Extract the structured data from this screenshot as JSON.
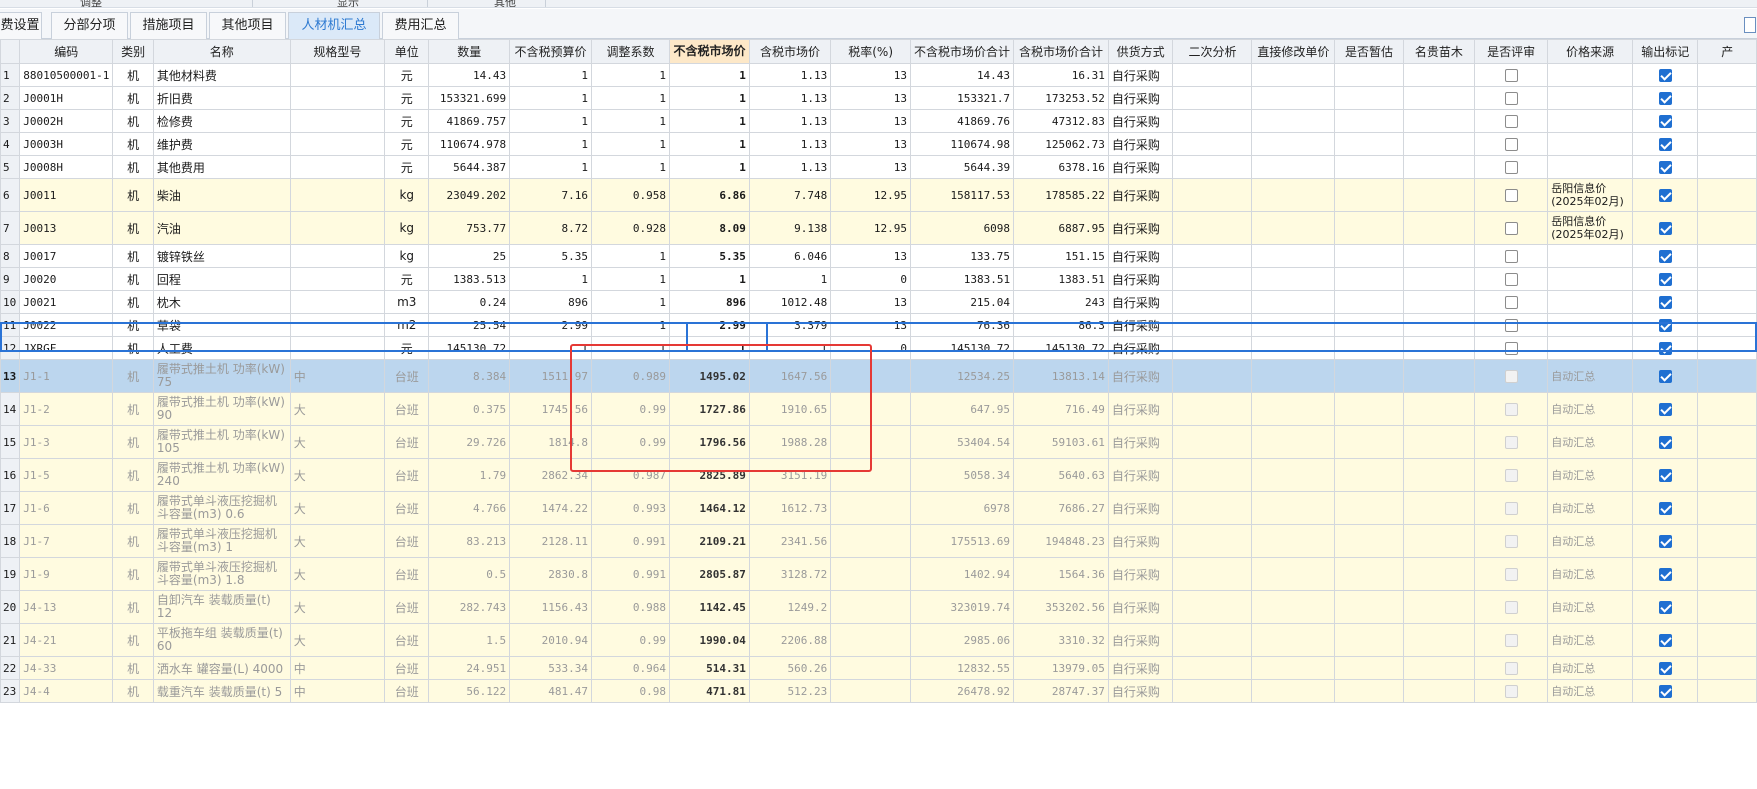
{
  "top_strip": [
    "调整",
    "显示",
    "其他"
  ],
  "tabs": [
    {
      "label": "费设置",
      "active": false
    },
    {
      "label": "分部分项",
      "active": false
    },
    {
      "label": "措施项目",
      "active": false
    },
    {
      "label": "其他项目",
      "active": false
    },
    {
      "label": "人材机汇总",
      "active": true
    },
    {
      "label": "费用汇总",
      "active": false
    }
  ],
  "columns": [
    "编码",
    "类别",
    "名称",
    "规格型号",
    "单位",
    "数量",
    "不含税预算价",
    "调整系数",
    "不含税市场价",
    "含税市场价",
    "税率(%)",
    "不含税市场价合计",
    "含税市场价合计",
    "供货方式",
    "二次分析",
    "直接修改单价",
    "是否暂估",
    "名贵苗木",
    "是否评审",
    "价格来源",
    "输出标记",
    "产"
  ],
  "colors": {
    "accent": "#2e7ad1",
    "highlight_header": "#fde8c8",
    "yellow_row": "#fffbe0",
    "selected_row": "#bcd6ee",
    "annotation_box": "#e53935"
  },
  "rows": [
    {
      "no": "1",
      "code": "88010500001-1",
      "cat": "机",
      "name": "其他材料费",
      "spec": "",
      "unit": "元",
      "qty": "14.43",
      "budget": "1",
      "coef": "1",
      "market": "1",
      "market_tax": "1.13",
      "rate": "13",
      "total": "14.43",
      "total_tax": "16.31",
      "supply": "自行采购",
      "src": "",
      "review": false,
      "output": true,
      "style": "white"
    },
    {
      "no": "2",
      "code": "J0001H",
      "cat": "机",
      "name": "折旧费",
      "spec": "",
      "unit": "元",
      "qty": "153321.699",
      "budget": "1",
      "coef": "1",
      "market": "1",
      "market_tax": "1.13",
      "rate": "13",
      "total": "153321.7",
      "total_tax": "173253.52",
      "supply": "自行采购",
      "src": "",
      "review": false,
      "output": true,
      "style": "white"
    },
    {
      "no": "3",
      "code": "J0002H",
      "cat": "机",
      "name": "检修费",
      "spec": "",
      "unit": "元",
      "qty": "41869.757",
      "budget": "1",
      "coef": "1",
      "market": "1",
      "market_tax": "1.13",
      "rate": "13",
      "total": "41869.76",
      "total_tax": "47312.83",
      "supply": "自行采购",
      "src": "",
      "review": false,
      "output": true,
      "style": "white"
    },
    {
      "no": "4",
      "code": "J0003H",
      "cat": "机",
      "name": "维护费",
      "spec": "",
      "unit": "元",
      "qty": "110674.978",
      "budget": "1",
      "coef": "1",
      "market": "1",
      "market_tax": "1.13",
      "rate": "13",
      "total": "110674.98",
      "total_tax": "125062.73",
      "supply": "自行采购",
      "src": "",
      "review": false,
      "output": true,
      "style": "white"
    },
    {
      "no": "5",
      "code": "J0008H",
      "cat": "机",
      "name": "其他费用",
      "spec": "",
      "unit": "元",
      "qty": "5644.387",
      "budget": "1",
      "coef": "1",
      "market": "1",
      "market_tax": "1.13",
      "rate": "13",
      "total": "5644.39",
      "total_tax": "6378.16",
      "supply": "自行采购",
      "src": "",
      "review": false,
      "output": true,
      "style": "white"
    },
    {
      "no": "6",
      "code": "J0011",
      "cat": "机",
      "name": "柴油",
      "spec": "",
      "unit": "kg",
      "qty": "23049.202",
      "budget": "7.16",
      "coef": "0.958",
      "market": "6.86",
      "market_tax": "7.748",
      "rate": "12.95",
      "total": "158117.53",
      "total_tax": "178585.22",
      "supply": "自行采购",
      "src": "岳阳信息价\n(2025年02月)",
      "review": false,
      "output": true,
      "style": "yellow tall"
    },
    {
      "no": "7",
      "code": "J0013",
      "cat": "机",
      "name": "汽油",
      "spec": "",
      "unit": "kg",
      "qty": "753.77",
      "budget": "8.72",
      "coef": "0.928",
      "market": "8.09",
      "market_tax": "9.138",
      "rate": "12.95",
      "total": "6098",
      "total_tax": "6887.95",
      "supply": "自行采购",
      "src": "岳阳信息价\n(2025年02月)",
      "review": false,
      "output": true,
      "style": "yellow tall"
    },
    {
      "no": "8",
      "code": "J0017",
      "cat": "机",
      "name": "镀锌铁丝",
      "spec": "",
      "unit": "kg",
      "qty": "25",
      "budget": "5.35",
      "coef": "1",
      "market": "5.35",
      "market_tax": "6.046",
      "rate": "13",
      "total": "133.75",
      "total_tax": "151.15",
      "supply": "自行采购",
      "src": "",
      "review": false,
      "output": true,
      "style": "white"
    },
    {
      "no": "9",
      "code": "J0020",
      "cat": "机",
      "name": "回程",
      "spec": "",
      "unit": "元",
      "qty": "1383.513",
      "budget": "1",
      "coef": "1",
      "market": "1",
      "market_tax": "1",
      "rate": "0",
      "total": "1383.51",
      "total_tax": "1383.51",
      "supply": "自行采购",
      "src": "",
      "review": false,
      "output": true,
      "style": "white"
    },
    {
      "no": "10",
      "code": "J0021",
      "cat": "机",
      "name": "枕木",
      "spec": "",
      "unit": "m3",
      "qty": "0.24",
      "budget": "896",
      "coef": "1",
      "market": "896",
      "market_tax": "1012.48",
      "rate": "13",
      "total": "215.04",
      "total_tax": "243",
      "supply": "自行采购",
      "src": "",
      "review": false,
      "output": true,
      "style": "white"
    },
    {
      "no": "11",
      "code": "J0022",
      "cat": "机",
      "name": "草袋",
      "spec": "",
      "unit": "m2",
      "qty": "25.54",
      "budget": "2.99",
      "coef": "1",
      "market": "2.99",
      "market_tax": "3.379",
      "rate": "13",
      "total": "76.36",
      "total_tax": "86.3",
      "supply": "自行采购",
      "src": "",
      "review": false,
      "output": true,
      "style": "white"
    },
    {
      "no": "12",
      "code": "JXRGF",
      "cat": "机",
      "name": "人工费",
      "spec": "",
      "unit": "元",
      "qty": "145130.72",
      "budget": "1",
      "coef": "1",
      "market": "1",
      "market_tax": "1",
      "rate": "0",
      "total": "145130.72",
      "total_tax": "145130.72",
      "supply": "自行采购",
      "src": "",
      "review": false,
      "output": true,
      "style": "white"
    },
    {
      "no": "13",
      "code": "J1-1",
      "cat": "机",
      "name": "履带式推土机 功率(kW)\n75",
      "spec": "中",
      "unit": "台班",
      "qty": "8.384",
      "budget": "1511.97",
      "coef": "0.989",
      "market": "1495.02",
      "market_tax": "1647.56",
      "rate": "",
      "total": "12534.25",
      "total_tax": "13813.14",
      "supply": "自行采购",
      "src": "自动汇总",
      "review": null,
      "output": true,
      "style": "grey selected tall"
    },
    {
      "no": "14",
      "code": "J1-2",
      "cat": "机",
      "name": "履带式推土机 功率(kW)\n90",
      "spec": "大",
      "unit": "台班",
      "qty": "0.375",
      "budget": "1745.56",
      "coef": "0.99",
      "market": "1727.86",
      "market_tax": "1910.65",
      "rate": "",
      "total": "647.95",
      "total_tax": "716.49",
      "supply": "自行采购",
      "src": "自动汇总",
      "review": null,
      "output": true,
      "style": "grey yellow tall"
    },
    {
      "no": "15",
      "code": "J1-3",
      "cat": "机",
      "name": "履带式推土机 功率(kW)\n105",
      "spec": "大",
      "unit": "台班",
      "qty": "29.726",
      "budget": "1814.8",
      "coef": "0.99",
      "market": "1796.56",
      "market_tax": "1988.28",
      "rate": "",
      "total": "53404.54",
      "total_tax": "59103.61",
      "supply": "自行采购",
      "src": "自动汇总",
      "review": null,
      "output": true,
      "style": "grey yellow tall"
    },
    {
      "no": "16",
      "code": "J1-5",
      "cat": "机",
      "name": "履带式推土机 功率(kW)\n240",
      "spec": "大",
      "unit": "台班",
      "qty": "1.79",
      "budget": "2862.34",
      "coef": "0.987",
      "market": "2825.89",
      "market_tax": "3151.19",
      "rate": "",
      "total": "5058.34",
      "total_tax": "5640.63",
      "supply": "自行采购",
      "src": "自动汇总",
      "review": null,
      "output": true,
      "style": "grey yellow tall"
    },
    {
      "no": "17",
      "code": "J1-6",
      "cat": "机",
      "name": "履带式单斗液压挖掘机\n斗容量(m3) 0.6",
      "spec": "大",
      "unit": "台班",
      "qty": "4.766",
      "budget": "1474.22",
      "coef": "0.993",
      "market": "1464.12",
      "market_tax": "1612.73",
      "rate": "",
      "total": "6978",
      "total_tax": "7686.27",
      "supply": "自行采购",
      "src": "自动汇总",
      "review": null,
      "output": true,
      "style": "grey yellow tall"
    },
    {
      "no": "18",
      "code": "J1-7",
      "cat": "机",
      "name": "履带式单斗液压挖掘机\n斗容量(m3) 1",
      "spec": "大",
      "unit": "台班",
      "qty": "83.213",
      "budget": "2128.11",
      "coef": "0.991",
      "market": "2109.21",
      "market_tax": "2341.56",
      "rate": "",
      "total": "175513.69",
      "total_tax": "194848.23",
      "supply": "自行采购",
      "src": "自动汇总",
      "review": null,
      "output": true,
      "style": "grey yellow tall"
    },
    {
      "no": "19",
      "code": "J1-9",
      "cat": "机",
      "name": "履带式单斗液压挖掘机\n斗容量(m3) 1.8",
      "spec": "大",
      "unit": "台班",
      "qty": "0.5",
      "budget": "2830.8",
      "coef": "0.991",
      "market": "2805.87",
      "market_tax": "3128.72",
      "rate": "",
      "total": "1402.94",
      "total_tax": "1564.36",
      "supply": "自行采购",
      "src": "自动汇总",
      "review": null,
      "output": true,
      "style": "grey yellow tall"
    },
    {
      "no": "20",
      "code": "J4-13",
      "cat": "机",
      "name": "自卸汽车 装载质量(t)\n12",
      "spec": "大",
      "unit": "台班",
      "qty": "282.743",
      "budget": "1156.43",
      "coef": "0.988",
      "market": "1142.45",
      "market_tax": "1249.2",
      "rate": "",
      "total": "323019.74",
      "total_tax": "353202.56",
      "supply": "自行采购",
      "src": "自动汇总",
      "review": null,
      "output": true,
      "style": "grey yellow tall"
    },
    {
      "no": "21",
      "code": "J4-21",
      "cat": "机",
      "name": "平板拖车组 装载质量(t)\n60",
      "spec": "大",
      "unit": "台班",
      "qty": "1.5",
      "budget": "2010.94",
      "coef": "0.99",
      "market": "1990.04",
      "market_tax": "2206.88",
      "rate": "",
      "total": "2985.06",
      "total_tax": "3310.32",
      "supply": "自行采购",
      "src": "自动汇总",
      "review": null,
      "output": true,
      "style": "grey yellow tall"
    },
    {
      "no": "22",
      "code": "J4-33",
      "cat": "机",
      "name": "洒水车 罐容量(L) 4000",
      "spec": "中",
      "unit": "台班",
      "qty": "24.951",
      "budget": "533.34",
      "coef": "0.964",
      "market": "514.31",
      "market_tax": "560.26",
      "rate": "",
      "total": "12832.55",
      "total_tax": "13979.05",
      "supply": "自行采购",
      "src": "自动汇总",
      "review": null,
      "output": true,
      "style": "grey yellow"
    },
    {
      "no": "23",
      "code": "J4-4",
      "cat": "机",
      "name": "载重汽车 装载质量(t) 5",
      "spec": "中",
      "unit": "台班",
      "qty": "56.122",
      "budget": "481.47",
      "coef": "0.98",
      "market": "471.81",
      "market_tax": "512.23",
      "rate": "",
      "total": "26478.92",
      "total_tax": "28747.37",
      "supply": "自行采购",
      "src": "自动汇总",
      "review": null,
      "output": true,
      "style": "grey yellow"
    }
  ]
}
